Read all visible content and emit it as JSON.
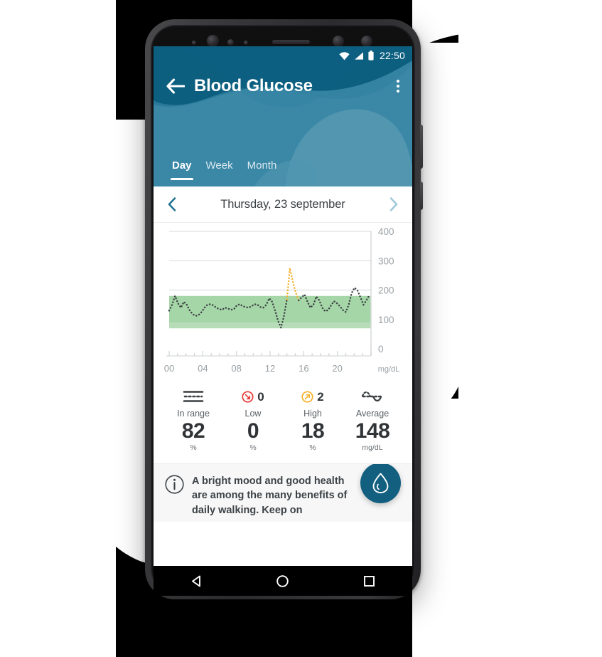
{
  "statusbar": {
    "time": "22:50",
    "icons": [
      "wifi-icon",
      "signal-icon",
      "battery-icon"
    ]
  },
  "header": {
    "title": "Blood Glucose",
    "back_icon": "back-arrow-icon",
    "overflow_icon": "overflow-menu-icon",
    "bg_color": "#2b7a9b",
    "wave_dark": "#0d5f80",
    "wave_mid": "#2e7e9e",
    "wave_light": "#5296b0"
  },
  "tabs": [
    {
      "label": "Day",
      "active": true
    },
    {
      "label": "Week",
      "active": false
    },
    {
      "label": "Month",
      "active": false
    }
  ],
  "date_nav": {
    "prev_icon": "chevron-left-icon",
    "next_icon": "chevron-right-icon",
    "label": "Thursday, 23 september",
    "prev_color": "#1c6f8f",
    "next_color": "#9dc6d6"
  },
  "chart_data": {
    "type": "line",
    "title": "",
    "xlabel": "",
    "ylabel": "",
    "unit_label": "mg/dL",
    "ylim": [
      0,
      400
    ],
    "yticks": [
      0,
      100,
      200,
      300,
      400
    ],
    "xlim": [
      0,
      24
    ],
    "xticks": [
      0,
      4,
      8,
      12,
      16,
      20
    ],
    "xticklabels": [
      "00",
      "04",
      "08",
      "12",
      "16",
      "20"
    ],
    "grid": true,
    "target_range": {
      "low": 70,
      "high": 180,
      "fill_color": "#a5d6a7",
      "inner_color": "#b7ddb8"
    },
    "line_style": "dotted",
    "line_color": "#3a3f42",
    "high_color": "#f5b027",
    "x": [
      0.0,
      0.35,
      0.7,
      1.05,
      1.4,
      1.75,
      2.1,
      2.45,
      2.8,
      3.15,
      3.5,
      3.85,
      4.2,
      4.55,
      4.9,
      5.25,
      5.6,
      5.95,
      6.3,
      6.65,
      7.0,
      7.35,
      7.7,
      8.05,
      8.4,
      8.75,
      9.1,
      9.45,
      9.8,
      10.15,
      10.5,
      10.85,
      11.2,
      11.55,
      11.9,
      12.25,
      12.6,
      12.95,
      13.3,
      13.65,
      14.0,
      14.35,
      14.7,
      15.05,
      15.4,
      15.75,
      16.1,
      16.45,
      16.8,
      17.15,
      17.5,
      17.85,
      18.2,
      18.55,
      18.9,
      19.25,
      19.6,
      19.95,
      20.3,
      20.65,
      21.0,
      21.35,
      21.7,
      22.05,
      22.4,
      22.75,
      23.1,
      23.45,
      23.8
    ],
    "y": [
      130,
      150,
      180,
      155,
      140,
      160,
      150,
      130,
      118,
      112,
      115,
      125,
      140,
      150,
      152,
      148,
      140,
      135,
      133,
      140,
      137,
      133,
      135,
      148,
      152,
      145,
      142,
      140,
      145,
      152,
      150,
      142,
      140,
      150,
      172,
      160,
      130,
      95,
      72,
      112,
      168,
      275,
      230,
      192,
      165,
      175,
      185,
      160,
      140,
      150,
      178,
      165,
      140,
      128,
      132,
      148,
      162,
      155,
      145,
      132,
      125,
      150,
      190,
      208,
      198,
      175,
      150,
      165,
      182
    ],
    "high_segment_indices": [
      40,
      41,
      42,
      43
    ],
    "series_name": "Blood glucose"
  },
  "stats": [
    {
      "icon": "in-range-icon",
      "count": "",
      "label": "In range",
      "value": "82",
      "unit": "%",
      "color": "#3a3f42"
    },
    {
      "icon": "low-arrow-icon",
      "count": "0",
      "label": "Low",
      "value": "0",
      "unit": "%",
      "color": "#e53935"
    },
    {
      "icon": "high-arrow-icon",
      "count": "2",
      "label": "High",
      "value": "18",
      "unit": "%",
      "color": "#f5b027"
    },
    {
      "icon": "average-wave-icon",
      "count": "",
      "label": "Average",
      "value": "148",
      "unit": "mg/dL",
      "color": "#3a3f42"
    }
  ],
  "tip": {
    "icon": "info-icon",
    "text": "A bright mood and good health are among the many benefits of daily walking. Keep on",
    "fab_icon": "water-drop-icon",
    "fab_color": "#135f80"
  },
  "navbar": {
    "back_icon": "nav-back-triangle-icon",
    "home_icon": "nav-home-circle-icon",
    "recents_icon": "nav-recents-square-icon"
  }
}
